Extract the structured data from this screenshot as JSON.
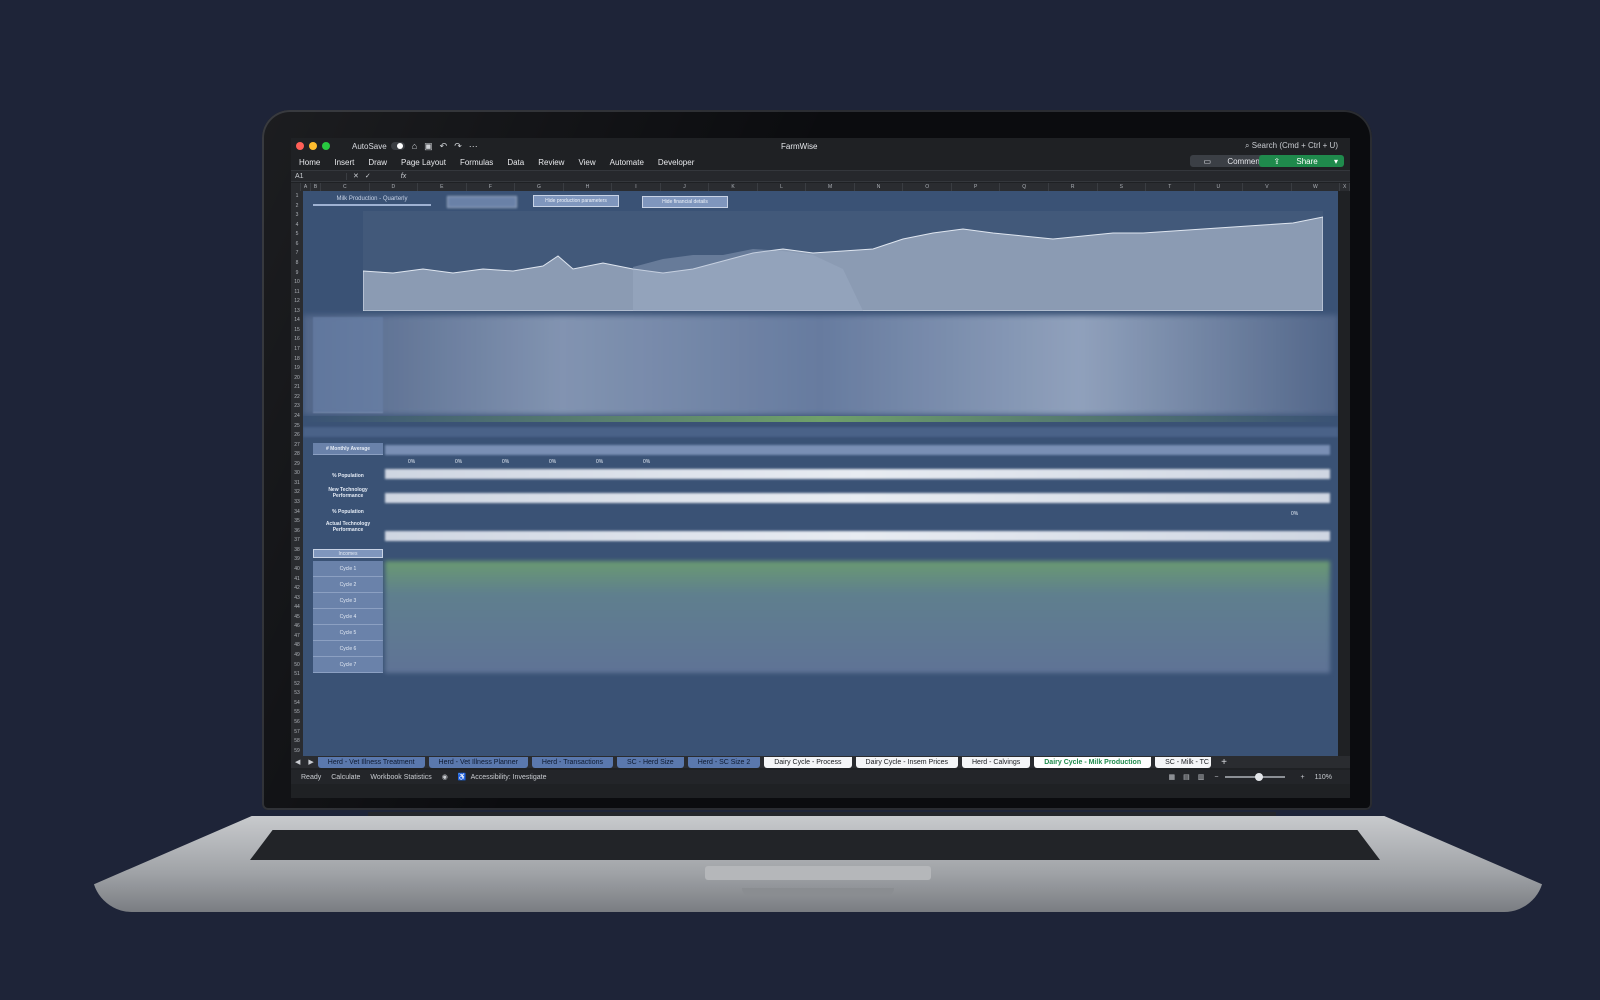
{
  "titlebar": {
    "autosave_label": "AutoSave",
    "doc_title": "FarmWise",
    "search_placeholder": "Search (Cmd + Ctrl + U)"
  },
  "ribbon": {
    "tabs": [
      "Home",
      "Insert",
      "Draw",
      "Page Layout",
      "Formulas",
      "Data",
      "Review",
      "View",
      "Automate",
      "Developer"
    ],
    "comments_label": "Comments",
    "share_label": "Share"
  },
  "formula_bar": {
    "name_box": "A1",
    "fx_label": "fx"
  },
  "columns": [
    "A",
    "B",
    "C",
    "D",
    "E",
    "F",
    "G",
    "H",
    "I",
    "J",
    "K",
    "L",
    "M",
    "N",
    "O",
    "P",
    "Q",
    "R",
    "S",
    "T",
    "U",
    "V",
    "W",
    "X"
  ],
  "sheet": {
    "title_tab": "Milk Production - Quarterly",
    "buttons": [
      "Hide production parameters",
      "Hide financial details"
    ],
    "row_labels": {
      "monthly_average": "# Monthly Average",
      "population": "% Population",
      "new_tech": "New Technology Performance",
      "population2": "% Population",
      "actual_tech": "Actual Technology Performance",
      "incomes": "Incomes",
      "cycles": [
        "Cycle 1",
        "Cycle 2",
        "Cycle 3",
        "Cycle 4",
        "Cycle 5",
        "Cycle 6",
        "Cycle 7"
      ]
    },
    "pct_values": [
      "0%",
      "0%",
      "0%",
      "0%",
      "0%",
      "0%"
    ],
    "right_pct": "0%"
  },
  "sheet_tabs": [
    {
      "label": "Herd - Vet Illness Treatment",
      "style": "blue"
    },
    {
      "label": "Herd - Vet Illness Planner",
      "style": "blue"
    },
    {
      "label": "Herd - Transactions",
      "style": "blue"
    },
    {
      "label": "SC - Herd Size",
      "style": "blue"
    },
    {
      "label": "Herd - SC Size 2",
      "style": "blue"
    },
    {
      "label": "Dairy Cycle - Process",
      "style": "white"
    },
    {
      "label": "Dairy Cycle - Insem Prices",
      "style": "white"
    },
    {
      "label": "Herd - Calvings",
      "style": "white"
    },
    {
      "label": "Dairy Cycle - Milk Production",
      "style": "active"
    },
    {
      "label": "SC - Milk - TC",
      "style": "white"
    }
  ],
  "status_bar": {
    "ready": "Ready",
    "calculate": "Calculate",
    "workbook_stats": "Workbook Statistics",
    "accessibility": "Accessibility: Investigate",
    "zoom": "110%"
  },
  "colors": {
    "accent_green": "#1f8a4c",
    "sheet_bg": "#3a5275",
    "tab_blue": "#5a78ad"
  }
}
